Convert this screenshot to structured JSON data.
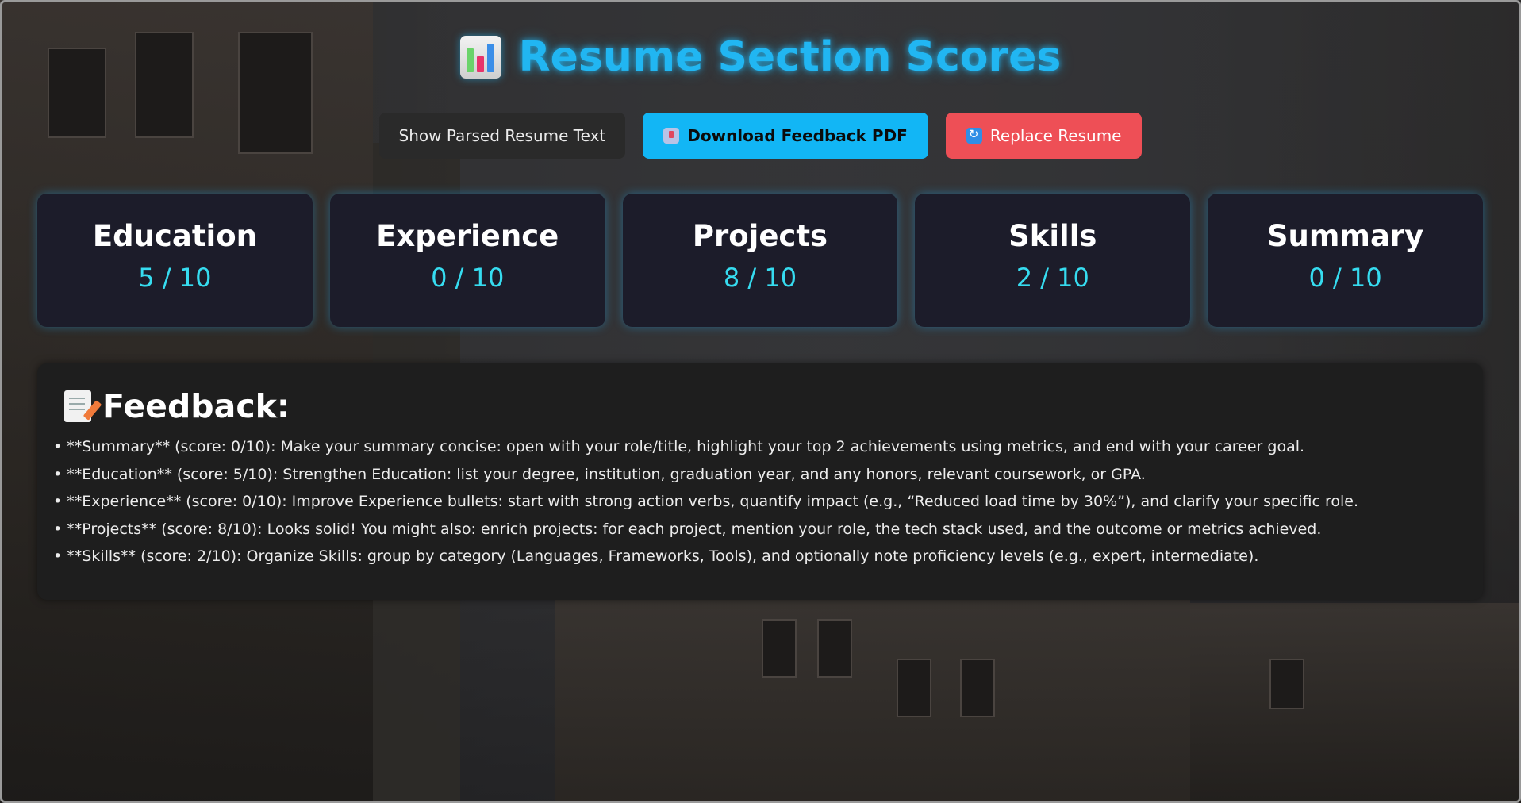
{
  "header": {
    "title": "Resume Section Scores",
    "icon": "bar-chart-icon"
  },
  "actions": {
    "show_parsed_label": "Show Parsed Resume Text",
    "download_label": "Download Feedback PDF",
    "download_icon": "inbox-tray-icon",
    "replace_label": "Replace Resume",
    "replace_icon": "refresh-icon"
  },
  "scores": [
    {
      "section": "Education",
      "score": "5 / 10"
    },
    {
      "section": "Experience",
      "score": "0 / 10"
    },
    {
      "section": "Projects",
      "score": "8 / 10"
    },
    {
      "section": "Skills",
      "score": "2 / 10"
    },
    {
      "section": "Summary",
      "score": "0 / 10"
    }
  ],
  "feedback": {
    "title": "Feedback:",
    "icon": "memo-icon",
    "items": [
      "**Summary** (score: 0/10): Make your summary concise: open with your role/title, highlight your top 2 achievements using metrics, and end with your career goal.",
      "**Education** (score: 5/10): Strengthen Education: list your degree, institution, graduation year, and any honors, relevant coursework, or GPA.",
      "**Experience** (score: 0/10): Improve Experience bullets: start with strong action verbs, quantify impact (e.g., “Reduced load time by 30%”), and clarify your specific role.",
      "**Projects** (score: 8/10): Looks solid! You might also: enrich projects: for each project, mention your role, the tech stack used, and the outcome or metrics achieved.",
      "**Skills** (score: 2/10): Organize Skills: group by category (Languages, Frameworks, Tools), and optionally note proficiency levels (e.g., expert, intermediate)."
    ]
  },
  "colors": {
    "accent": "#21b6f2",
    "score_value": "#36dcf0",
    "replace_button": "#ee4f56",
    "download_button": "#12b6f5"
  }
}
